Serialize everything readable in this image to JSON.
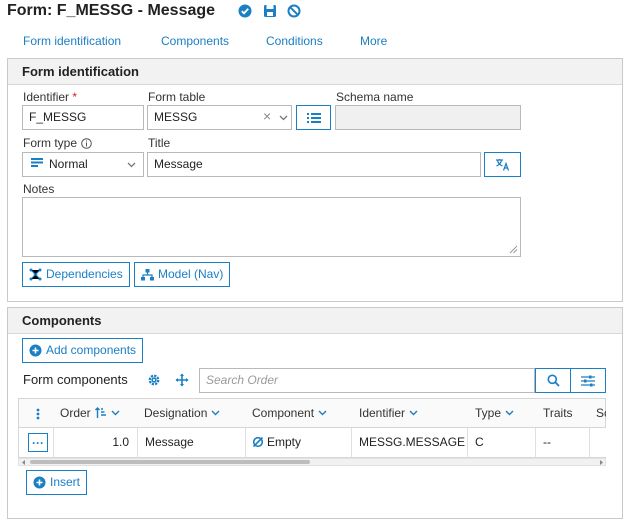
{
  "header": {
    "title": "Form: F_MESSG - Message",
    "icons": [
      "check-circle-icon",
      "save-icon",
      "cancel-icon"
    ],
    "accent": "#1a7fc4"
  },
  "tabs": [
    {
      "label": "Form identification"
    },
    {
      "label": "Components"
    },
    {
      "label": "Conditions"
    },
    {
      "label": "More"
    }
  ],
  "form_identification": {
    "title": "Form identification",
    "identifier": {
      "label": "Identifier",
      "required_mark": "*",
      "value": "F_MESSG"
    },
    "form_table": {
      "label": "Form table",
      "value": "MESSG",
      "clear_glyph": "×"
    },
    "schema_name": {
      "label": "Schema name",
      "value": ""
    },
    "form_type": {
      "label": "Form type",
      "value": "Normal"
    },
    "title_field": {
      "label": "Title",
      "value": "Message"
    },
    "notes": {
      "label": "Notes",
      "value": ""
    },
    "dependencies_button": "Dependencies",
    "model_button": "Model (Nav)"
  },
  "components": {
    "title": "Components",
    "add_button": "Add components",
    "form_components_label": "Form components",
    "search_placeholder": "Search Order",
    "columns": [
      {
        "label": "Order"
      },
      {
        "label": "Designation"
      },
      {
        "label": "Component"
      },
      {
        "label": "Identifier"
      },
      {
        "label": "Type"
      },
      {
        "label": "Traits"
      },
      {
        "label": "Sc"
      }
    ],
    "rows": [
      {
        "actions": "···",
        "order": "1.0",
        "designation": "Message",
        "component": "Empty",
        "identifier": "MESSG.MESSAGE",
        "type": "C",
        "traits": "--"
      }
    ],
    "insert_button": "Insert"
  }
}
